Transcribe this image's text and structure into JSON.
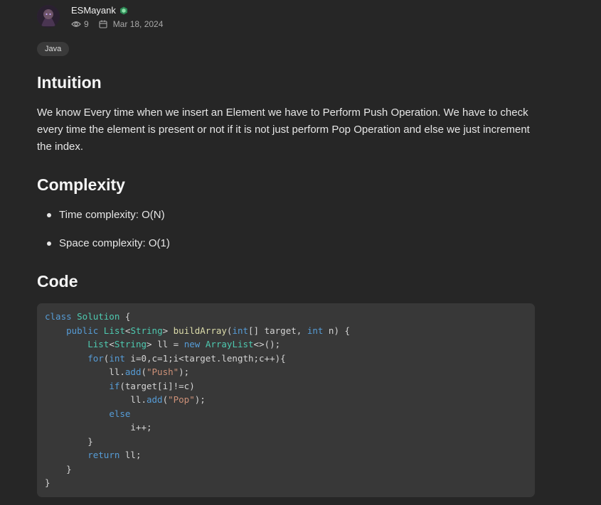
{
  "author": {
    "name": "ESMayank",
    "badge_icon": "hexagon-badge-icon",
    "views": "9",
    "date": "Mar 18, 2024"
  },
  "tag": "Java",
  "sections": {
    "intuition": {
      "heading": "Intuition",
      "text": "We know Every time when we insert an Element we have to Perform Push Operation. We have to check every time the element is present or not if it is not just perform Pop Operation and else we just increment the index."
    },
    "complexity": {
      "heading": "Complexity",
      "items": [
        "Time complexity: O(N)",
        "Space complexity: O(1)"
      ]
    },
    "code": {
      "heading": "Code",
      "lines": [
        [
          [
            "kw",
            "class "
          ],
          [
            "ty",
            "Solution "
          ],
          [
            "pl",
            "{"
          ]
        ],
        [
          [
            "pl",
            "    "
          ],
          [
            "kw",
            "public "
          ],
          [
            "ty",
            "List"
          ],
          [
            "pl",
            "<"
          ],
          [
            "ty",
            "String"
          ],
          [
            "pl",
            "> "
          ],
          [
            "fn",
            "buildArray"
          ],
          [
            "pl",
            "("
          ],
          [
            "kw",
            "int"
          ],
          [
            "pl",
            "[] target, "
          ],
          [
            "kw",
            "int"
          ],
          [
            "pl",
            " n) {"
          ]
        ],
        [
          [
            "pl",
            "        "
          ],
          [
            "ty",
            "List"
          ],
          [
            "pl",
            "<"
          ],
          [
            "ty",
            "String"
          ],
          [
            "pl",
            "> ll = "
          ],
          [
            "kw",
            "new "
          ],
          [
            "ty",
            "ArrayList"
          ],
          [
            "pl",
            "<>();"
          ]
        ],
        [
          [
            "pl",
            "        "
          ],
          [
            "kw",
            "for"
          ],
          [
            "pl",
            "("
          ],
          [
            "kw",
            "int"
          ],
          [
            "pl",
            " i=0,c=1;i<target.length;c++){"
          ]
        ],
        [
          [
            "pl",
            "            ll."
          ],
          [
            "kw",
            "add"
          ],
          [
            "pl",
            "("
          ],
          [
            "st",
            "\"Push\""
          ],
          [
            "pl",
            ");"
          ]
        ],
        [
          [
            "pl",
            "            "
          ],
          [
            "kw",
            "if"
          ],
          [
            "pl",
            "(target[i]!=c)"
          ]
        ],
        [
          [
            "pl",
            "                ll."
          ],
          [
            "kw",
            "add"
          ],
          [
            "pl",
            "("
          ],
          [
            "st",
            "\"Pop\""
          ],
          [
            "pl",
            ");"
          ]
        ],
        [
          [
            "pl",
            "            "
          ],
          [
            "kw",
            "else"
          ]
        ],
        [
          [
            "pl",
            "                i++;"
          ]
        ],
        [
          [
            "pl",
            "        }"
          ]
        ],
        [
          [
            "pl",
            "        "
          ],
          [
            "kw",
            "return"
          ],
          [
            "pl",
            " ll;"
          ]
        ],
        [
          [
            "pl",
            "    }"
          ]
        ],
        [
          [
            "pl",
            "}"
          ]
        ]
      ]
    }
  }
}
